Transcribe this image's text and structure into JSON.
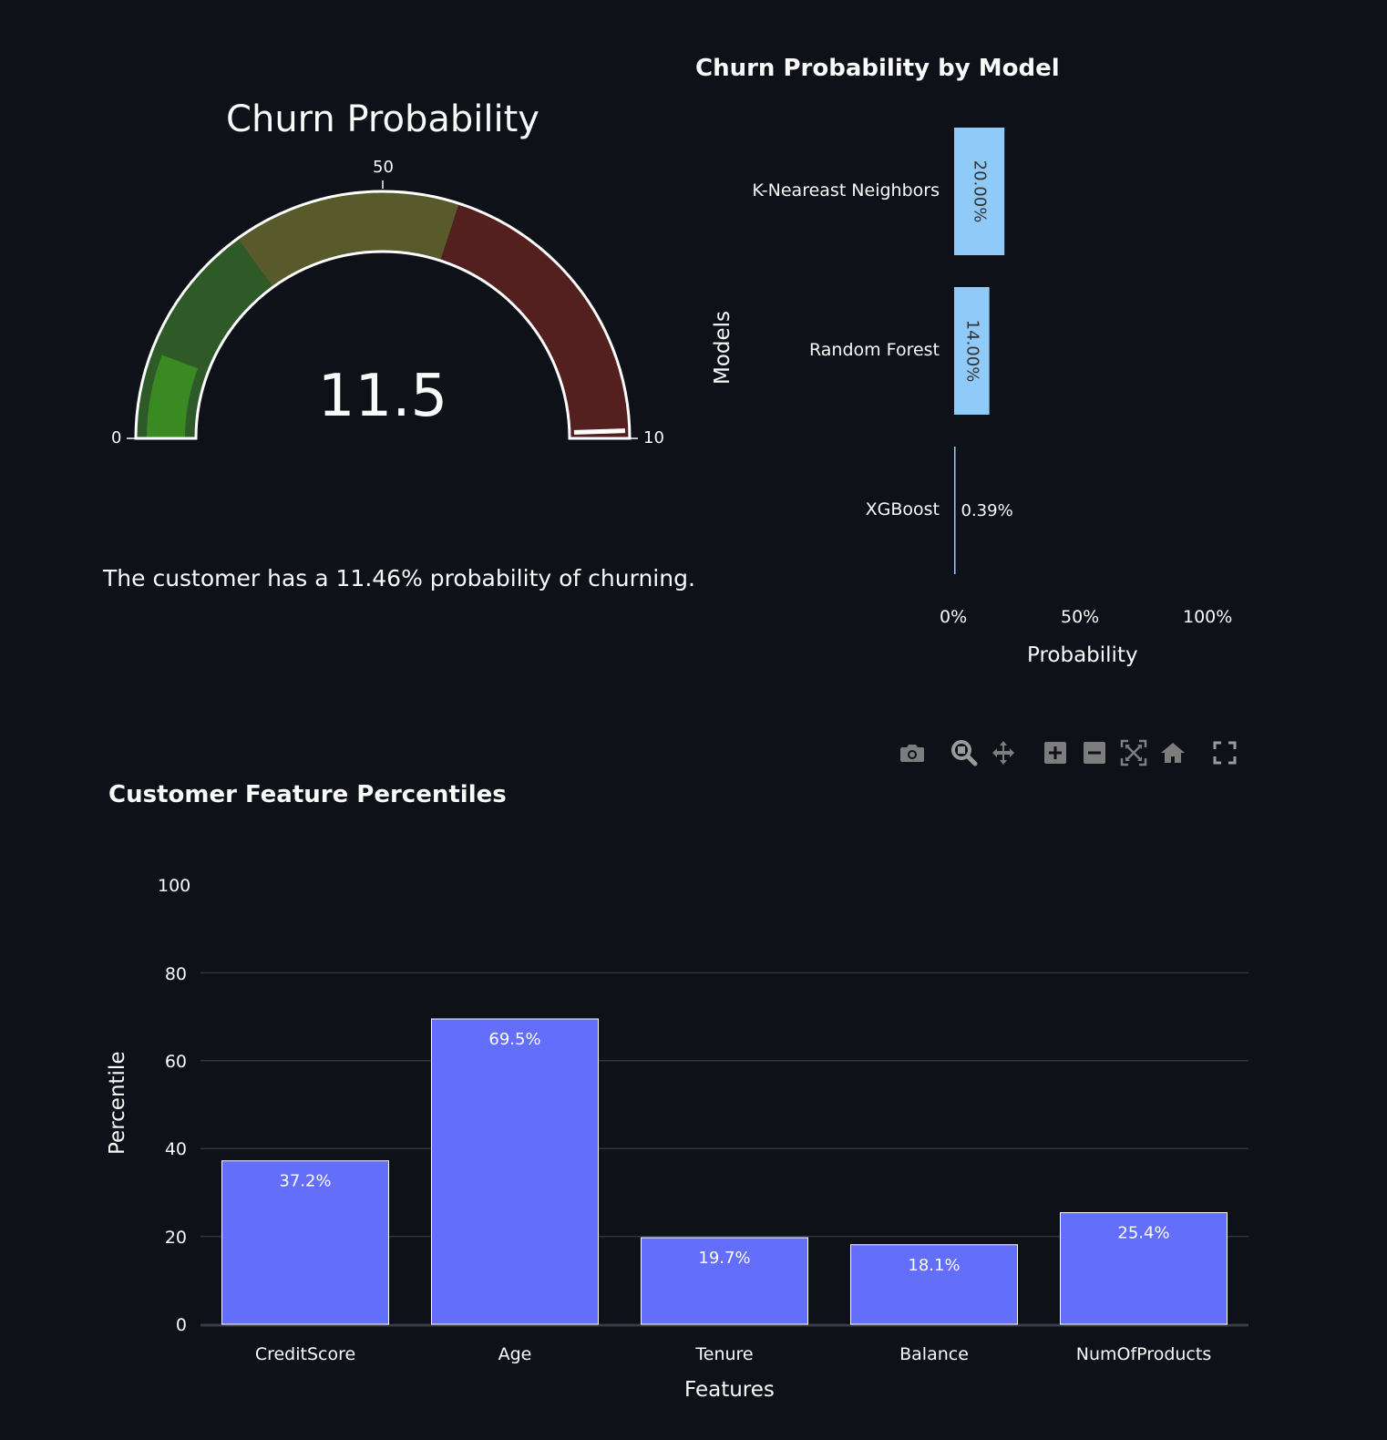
{
  "gauge": {
    "title": "Churn Probability",
    "value": 11.5,
    "value_display": "11.5",
    "min_label": "0",
    "mid_label": "50",
    "max_label": "10",
    "bands": [
      {
        "from": 0,
        "to": 30,
        "color": "#2e5a27"
      },
      {
        "from": 30,
        "to": 60,
        "color": "#585a2c"
      },
      {
        "from": 60,
        "to": 100,
        "color": "#531f1f"
      }
    ],
    "bar_color": "#3a8a23",
    "threshold_value": 99
  },
  "summary": {
    "text": "The customer has a 11.46% probability of churning."
  },
  "model_chart": {
    "title": "Churn Probability by Model",
    "y_axis_title": "Models",
    "x_axis_title": "Probability",
    "x_ticks": [
      "0%",
      "50%",
      "100%"
    ],
    "models": [
      {
        "name": "K-Neareast Neighbors",
        "label": "20.00%"
      },
      {
        "name": "Random Forest",
        "label": "14.00%"
      },
      {
        "name": "XGBoost",
        "label": "0.39%"
      }
    ]
  },
  "modebar": {
    "icons": [
      "camera-icon",
      "zoom-icon",
      "pan-icon",
      "zoom-in-icon",
      "zoom-out-icon",
      "autoscale-icon",
      "reset-axes-icon",
      "fullscreen-icon"
    ]
  },
  "feature_chart": {
    "title": "Customer Feature Percentiles",
    "x_axis_title": "Features",
    "y_axis_title": "Percentile",
    "y_ticks": [
      "0",
      "20",
      "40",
      "60",
      "80",
      "100"
    ]
  },
  "chart_data": [
    {
      "type": "bar",
      "orientation": "horizontal",
      "title": "Churn Probability by Model",
      "xlabel": "Probability",
      "ylabel": "Models",
      "categories": [
        "K-Neareast Neighbors",
        "Random Forest",
        "XGBoost"
      ],
      "values": [
        0.2,
        0.14,
        0.0039
      ],
      "data_labels": [
        "20.00%",
        "14.00%",
        "0.39%"
      ],
      "xlim": [
        0,
        1
      ],
      "color": "#90caf9"
    },
    {
      "type": "bar",
      "title": "Customer Feature Percentiles",
      "xlabel": "Features",
      "ylabel": "Percentile",
      "categories": [
        "CreditScore",
        "Age",
        "Tenure",
        "Balance",
        "NumOfProducts"
      ],
      "values": [
        37.2,
        69.5,
        19.7,
        18.1,
        25.4
      ],
      "data_labels": [
        "37.2%",
        "69.5%",
        "19.7%",
        "18.1%",
        "25.4%"
      ],
      "ylim": [
        0,
        100
      ],
      "grid": true,
      "color": "#636efa"
    }
  ]
}
